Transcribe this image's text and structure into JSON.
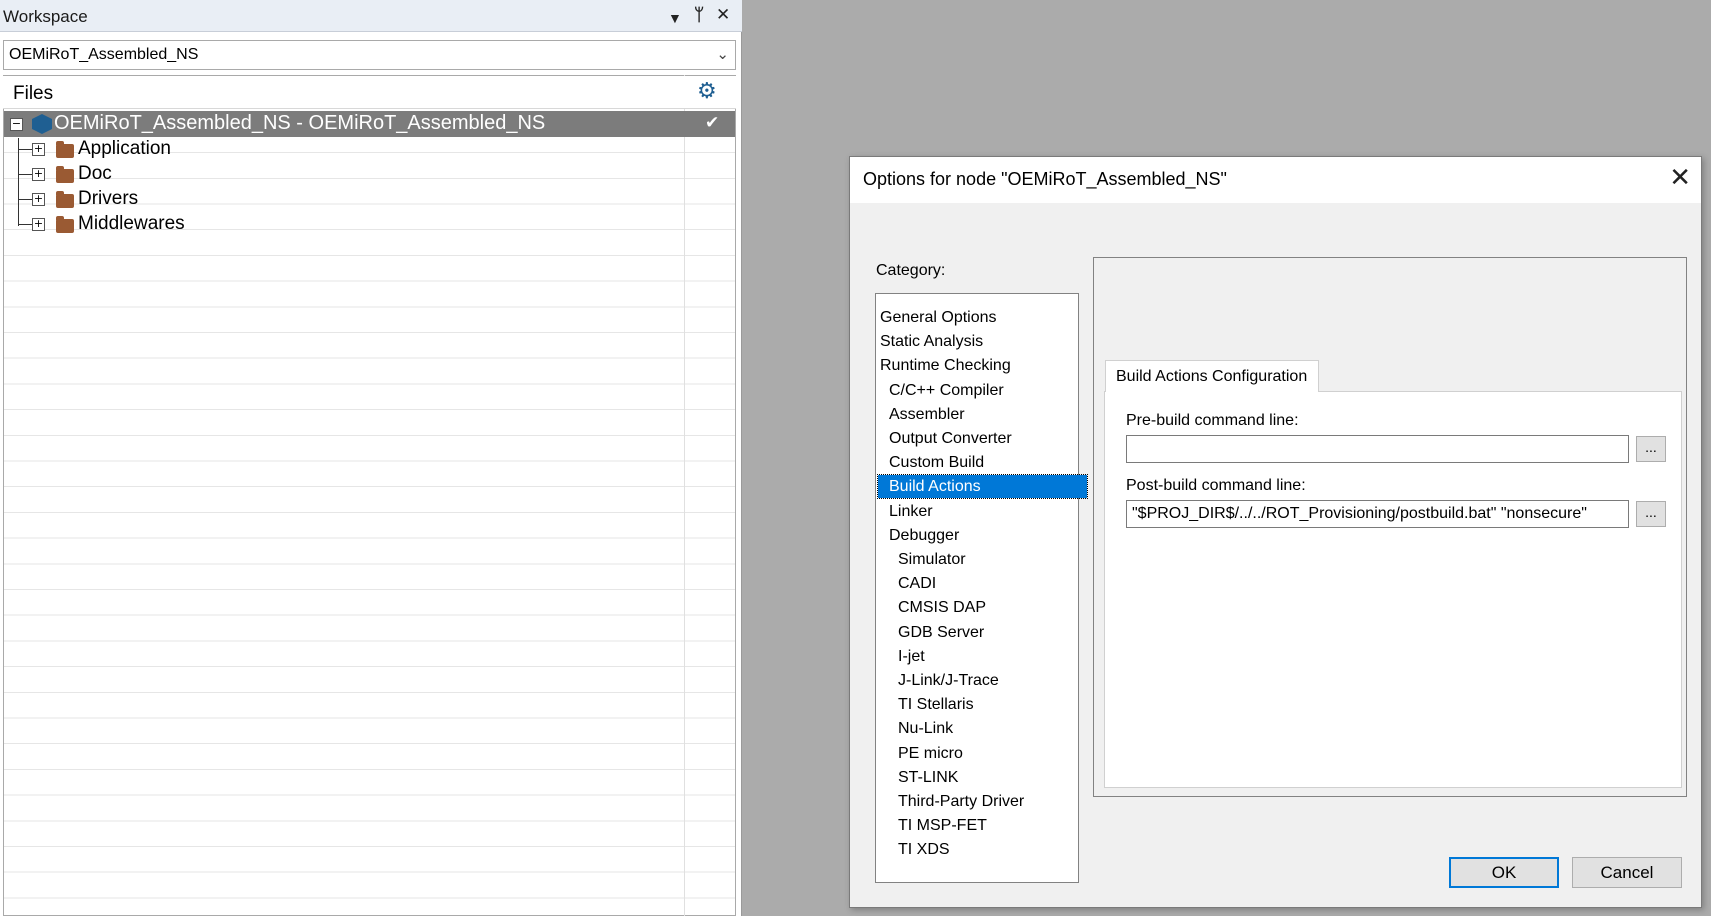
{
  "workspace": {
    "title": "Workspace",
    "dropdown_glyph": "▼",
    "pin_glyph": "ᛘ",
    "close_glyph": "✕",
    "config_selected": "OEMiRoT_Assembled_NS",
    "files_header": "Files",
    "settings_icon": "⚙",
    "tree": {
      "root": "OEMiRoT_Assembled_NS - OEMiRoT_Assembled_NS",
      "root_check": "✔",
      "children": [
        "Application",
        "Doc",
        "Drivers",
        "Middlewares"
      ]
    }
  },
  "dialog": {
    "title": "Options for node \"OEMiRoT_Assembled_NS\"",
    "close_glyph": "✕",
    "category_label": "Category:",
    "categories": [
      {
        "label": "General Options",
        "indent": 0
      },
      {
        "label": "Static Analysis",
        "indent": 0
      },
      {
        "label": "Runtime Checking",
        "indent": 0
      },
      {
        "label": "C/C++ Compiler",
        "indent": 1
      },
      {
        "label": "Assembler",
        "indent": 1
      },
      {
        "label": "Output Converter",
        "indent": 1
      },
      {
        "label": "Custom Build",
        "indent": 1
      },
      {
        "label": "Build Actions",
        "indent": 1,
        "selected": true
      },
      {
        "label": "Linker",
        "indent": 1
      },
      {
        "label": "Debugger",
        "indent": 1
      },
      {
        "label": "Simulator",
        "indent": 2
      },
      {
        "label": "CADI",
        "indent": 2
      },
      {
        "label": "CMSIS DAP",
        "indent": 2
      },
      {
        "label": "GDB Server",
        "indent": 2
      },
      {
        "label": "I-jet",
        "indent": 2
      },
      {
        "label": "J-Link/J-Trace",
        "indent": 2
      },
      {
        "label": "TI Stellaris",
        "indent": 2
      },
      {
        "label": "Nu-Link",
        "indent": 2
      },
      {
        "label": "PE micro",
        "indent": 2
      },
      {
        "label": "ST-LINK",
        "indent": 2
      },
      {
        "label": "Third-Party Driver",
        "indent": 2
      },
      {
        "label": "TI MSP-FET",
        "indent": 2
      },
      {
        "label": "TI XDS",
        "indent": 2
      }
    ],
    "tab_label": "Build Actions Configuration",
    "prebuild_label": "Pre-build command line:",
    "prebuild_value": "",
    "postbuild_label": "Post-build command line:",
    "postbuild_value": "\"$PROJ_DIR$/../../ROT_Provisioning/postbuild.bat\" \"nonsecure\"",
    "browse_label": "...",
    "ok_label": "OK",
    "cancel_label": "Cancel"
  },
  "colors": {
    "selection": "#0078d7",
    "root_row_bg": "#7c7c7c",
    "folder": "#9a5a33",
    "background": "#ababab"
  }
}
